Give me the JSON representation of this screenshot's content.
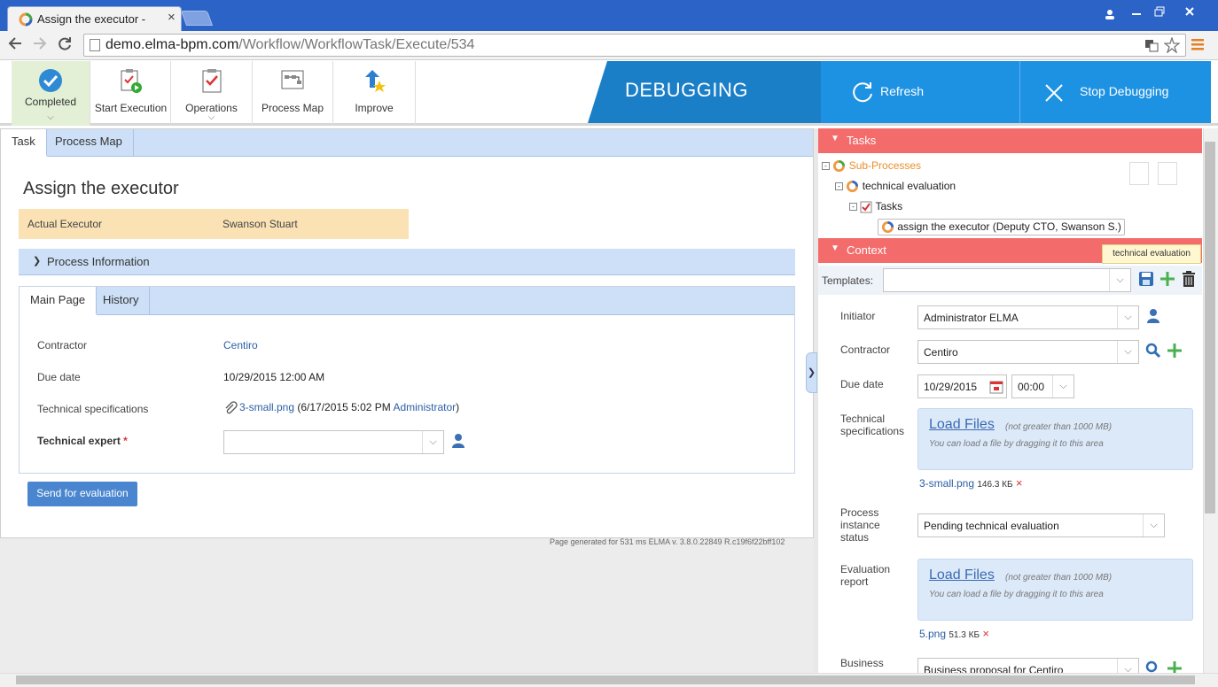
{
  "browser": {
    "tab_title": "Assign the executor -",
    "tab_close": "×",
    "url_host": "demo.elma-bpm.com",
    "url_path": "/Workflow/WorkflowTask/Execute/534"
  },
  "toolbar": {
    "completed": "Completed",
    "start_execution": "Start Execution",
    "operations": "Operations",
    "process_map": "Process Map",
    "improve": "Improve",
    "debugging": "DEBUGGING",
    "refresh": "Refresh",
    "stop_debugging": "Stop Debugging"
  },
  "left": {
    "tabs": [
      "Task",
      "Process Map"
    ],
    "title": "Assign the executor",
    "actual_executor_label": "Actual Executor",
    "actual_executor_value": "Swanson Stuart",
    "process_information": "Process Information",
    "inner_tabs": [
      "Main Page",
      "History"
    ],
    "fields": {
      "contractor_label": "Contractor",
      "contractor_value": "Centiro",
      "due_date_label": "Due date",
      "due_date_value": "10/29/2015 12:00 AM",
      "tech_spec_label": "Technical specifications",
      "tech_spec_file": "3-small.png",
      "tech_spec_meta": "(6/17/2015 5:02 PM",
      "tech_spec_user": "Administrator",
      "tech_spec_close": ")",
      "tech_expert_label": "Technical expert",
      "required_mark": "*"
    },
    "send_button": "Send for evaluation",
    "footer": "Page generated for 531 ms ELMA v. 3.8.0.22849 R.c19f6f22bff102"
  },
  "right": {
    "tasks_header": "Tasks",
    "tree": {
      "sub_processes": "Sub-Processes",
      "technical_evaluation": "technical evaluation",
      "tasks": "Tasks",
      "assign_executor": "assign the executor (Deputy CTO, Swanson S.)"
    },
    "context_header": "Context",
    "tooltip": "technical evaluation",
    "templates_label": "Templates:",
    "initiator_label": "Initiator",
    "initiator_value": "Administrator ELMA",
    "contractor_label": "Contractor",
    "contractor_value": "Centiro",
    "due_date_label": "Due date",
    "due_date_value": "10/29/2015",
    "due_time_value": "00:00",
    "tech_spec_label": "Technical specifications",
    "load_files": "Load Files",
    "not_greater": "(not greater than 1000 MB)",
    "drag_hint": "You can load a file by dragging it to this area",
    "tech_file_name": "3-small.png",
    "tech_file_size": "146.3 КБ",
    "status_label": "Process instance status",
    "status_value": "Pending technical evaluation",
    "eval_report_label": "Evaluation report",
    "eval_file_name": "5.png",
    "eval_file_size": "51.3 КБ",
    "business_label": "Business",
    "business_value": "Business proposal for Centiro",
    "delete_mark": "×"
  },
  "colors": {
    "debug_blue": "#1b7fc8",
    "action_blue": "#1e92e2",
    "red_header": "#f46b6b",
    "light_blue": "#cde0f7",
    "executor_bar": "#fbe2b5"
  }
}
